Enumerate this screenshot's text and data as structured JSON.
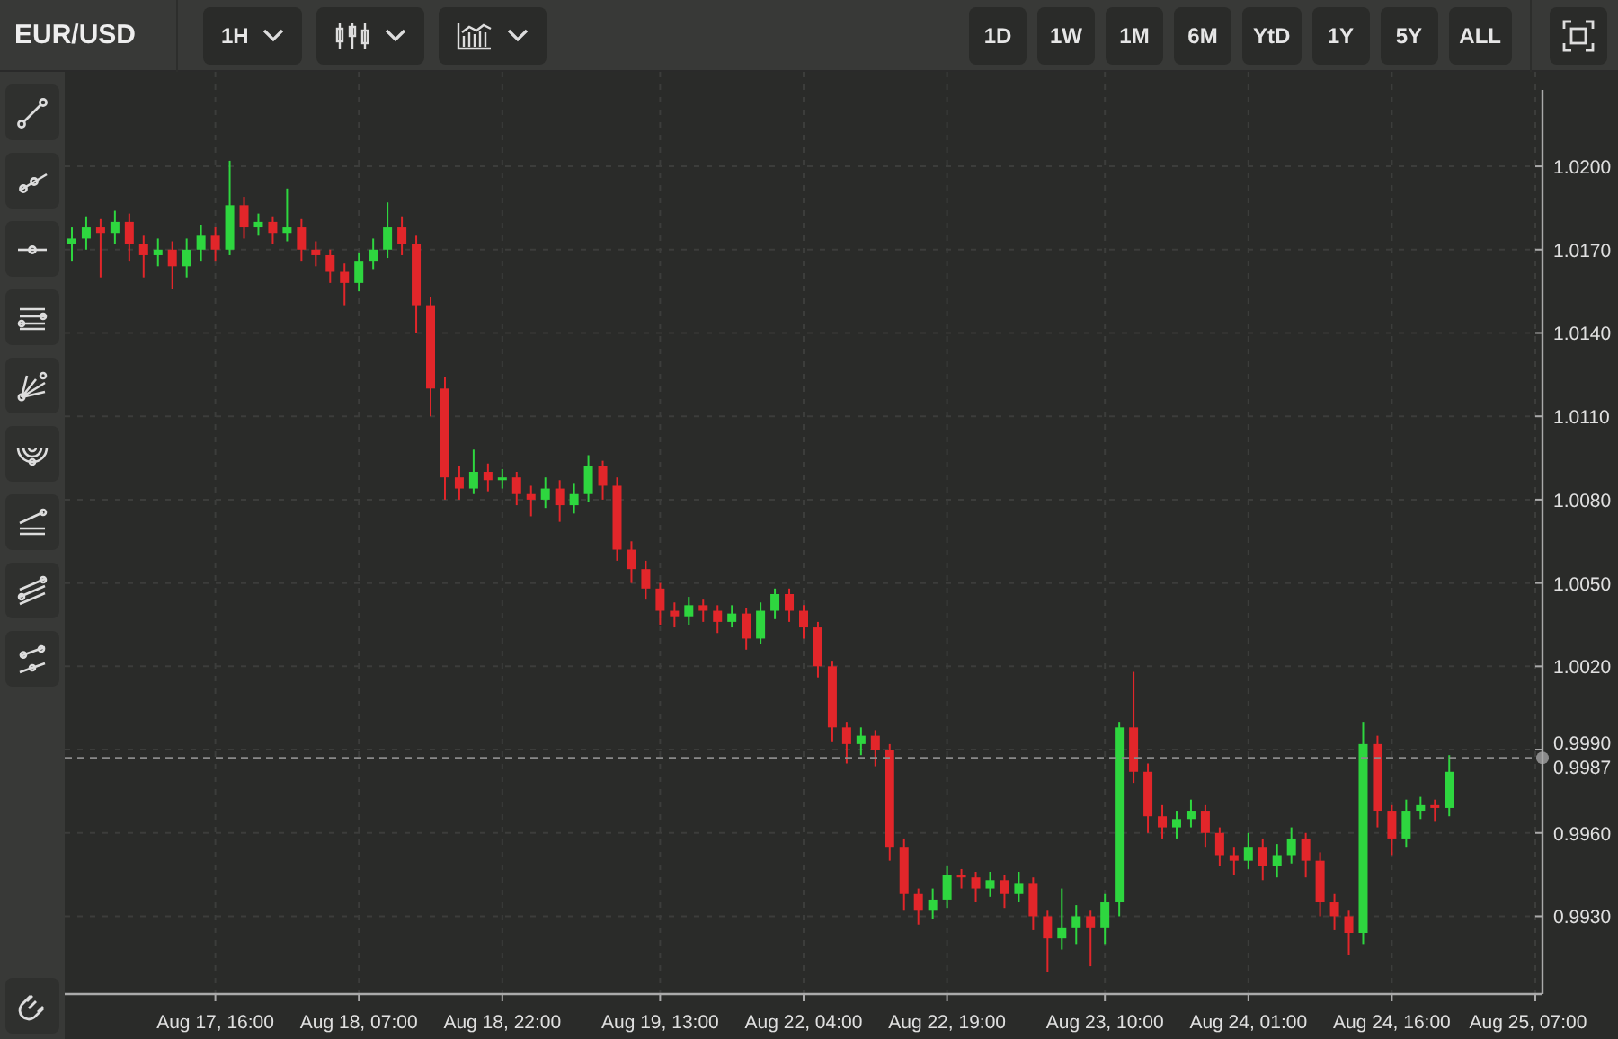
{
  "toolbar": {
    "symbol": "EUR/USD",
    "interval": "1H",
    "ranges": [
      {
        "label": "1D"
      },
      {
        "label": "1W"
      },
      {
        "label": "1M"
      },
      {
        "label": "6M"
      },
      {
        "label": "YtD"
      },
      {
        "label": "1Y"
      },
      {
        "label": "5Y"
      },
      {
        "label": "ALL"
      }
    ]
  },
  "chart": {
    "chart_data": {
      "type": "candlestick",
      "grid": true,
      "ref_lines": [
        {
          "axis": "y",
          "value": 0.9987,
          "label": "0.9987"
        }
      ],
      "categories": [
        null,
        null,
        null,
        null,
        null,
        null,
        null,
        null,
        null,
        null,
        "Aug 17, 16:00",
        null,
        null,
        null,
        null,
        null,
        null,
        null,
        null,
        null,
        "Aug 18, 07:00",
        null,
        null,
        null,
        null,
        null,
        null,
        null,
        null,
        null,
        "Aug 18, 22:00",
        null,
        null,
        null,
        null,
        null,
        null,
        null,
        null,
        null,
        null,
        "Aug 19, 13:00",
        null,
        null,
        null,
        null,
        null,
        null,
        null,
        null,
        null,
        "Aug 22, 04:00",
        null,
        null,
        null,
        null,
        null,
        null,
        null,
        null,
        null,
        "Aug 22, 19:00",
        null,
        null,
        null,
        null,
        null,
        null,
        null,
        null,
        null,
        null,
        "Aug 23, 10:00",
        null,
        null,
        null,
        null,
        null,
        null,
        null,
        null,
        null,
        "Aug 24, 01:00",
        null,
        null,
        null,
        null,
        null,
        null,
        null,
        null,
        null,
        "Aug 24, 16:00",
        null,
        null,
        null,
        null,
        null,
        null,
        null,
        null,
        null,
        "Aug 25, 07:00"
      ],
      "ohlc": [
        [
          1.0172,
          1.0178,
          1.0166,
          1.0174
        ],
        [
          1.0174,
          1.0182,
          1.017,
          1.0178
        ],
        [
          1.0178,
          1.0181,
          1.016,
          1.0176
        ],
        [
          1.0176,
          1.0184,
          1.0172,
          1.018
        ],
        [
          1.018,
          1.0183,
          1.0166,
          1.0172
        ],
        [
          1.0172,
          1.0175,
          1.016,
          1.0168
        ],
        [
          1.0168,
          1.0174,
          1.0164,
          1.017
        ],
        [
          1.017,
          1.0173,
          1.0156,
          1.0164
        ],
        [
          1.0164,
          1.0174,
          1.016,
          1.017
        ],
        [
          1.017,
          1.0179,
          1.0166,
          1.0175
        ],
        [
          1.0175,
          1.0178,
          1.0166,
          1.017
        ],
        [
          1.017,
          1.0202,
          1.0168,
          1.0186
        ],
        [
          1.0186,
          1.0189,
          1.0174,
          1.0178
        ],
        [
          1.0178,
          1.0183,
          1.0175,
          1.018
        ],
        [
          1.018,
          1.0182,
          1.0172,
          1.0176
        ],
        [
          1.0176,
          1.0192,
          1.0173,
          1.0178
        ],
        [
          1.0178,
          1.0181,
          1.0166,
          1.017
        ],
        [
          1.017,
          1.0173,
          1.0164,
          1.0168
        ],
        [
          1.0168,
          1.017,
          1.0158,
          1.0162
        ],
        [
          1.0162,
          1.0165,
          1.015,
          1.0158
        ],
        [
          1.0158,
          1.0169,
          1.0155,
          1.0166
        ],
        [
          1.0166,
          1.0174,
          1.0163,
          1.017
        ],
        [
          1.017,
          1.0187,
          1.0167,
          1.0178
        ],
        [
          1.0178,
          1.0182,
          1.0168,
          1.0172
        ],
        [
          1.0172,
          1.0175,
          1.014,
          1.015
        ],
        [
          1.015,
          1.0153,
          1.011,
          1.012
        ],
        [
          1.012,
          1.0124,
          1.008,
          1.0088
        ],
        [
          1.0088,
          1.0092,
          1.008,
          1.0084
        ],
        [
          1.0084,
          1.0098,
          1.0082,
          1.009
        ],
        [
          1.009,
          1.0093,
          1.0083,
          1.0087
        ],
        [
          1.0087,
          1.0091,
          1.0084,
          1.0088
        ],
        [
          1.0088,
          1.009,
          1.0078,
          1.0082
        ],
        [
          1.0082,
          1.0085,
          1.0074,
          1.008
        ],
        [
          1.008,
          1.0088,
          1.0077,
          1.0084
        ],
        [
          1.0084,
          1.0087,
          1.0072,
          1.0078
        ],
        [
          1.0078,
          1.0086,
          1.0075,
          1.0082
        ],
        [
          1.0082,
          1.0096,
          1.0079,
          1.0092
        ],
        [
          1.0092,
          1.0094,
          1.008,
          1.0085
        ],
        [
          1.0085,
          1.0088,
          1.0058,
          1.0062
        ],
        [
          1.0062,
          1.0065,
          1.005,
          1.0055
        ],
        [
          1.0055,
          1.0058,
          1.0044,
          1.0048
        ],
        [
          1.0048,
          1.005,
          1.0035,
          1.004
        ],
        [
          1.004,
          1.0043,
          1.0034,
          1.0038
        ],
        [
          1.0038,
          1.0045,
          1.0035,
          1.0042
        ],
        [
          1.0042,
          1.0044,
          1.0036,
          1.004
        ],
        [
          1.004,
          1.0042,
          1.0032,
          1.0036
        ],
        [
          1.0036,
          1.0042,
          1.0034,
          1.0039
        ],
        [
          1.0039,
          1.0041,
          1.0026,
          1.003
        ],
        [
          1.003,
          1.0043,
          1.0028,
          1.004
        ],
        [
          1.004,
          1.0048,
          1.0037,
          1.0046
        ],
        [
          1.0046,
          1.0048,
          1.0036,
          1.004
        ],
        [
          1.004,
          1.0042,
          1.003,
          1.0034
        ],
        [
          1.0034,
          1.0036,
          1.0016,
          1.002
        ],
        [
          1.002,
          1.0022,
          0.9993,
          0.9998
        ],
        [
          0.9998,
          1.0,
          0.9985,
          0.9992
        ],
        [
          0.9992,
          0.9998,
          0.9988,
          0.9995
        ],
        [
          0.9995,
          0.9997,
          0.9984,
          0.999
        ],
        [
          0.999,
          0.9992,
          0.995,
          0.9955
        ],
        [
          0.9955,
          0.9958,
          0.9932,
          0.9938
        ],
        [
          0.9938,
          0.994,
          0.9927,
          0.9932
        ],
        [
          0.9932,
          0.994,
          0.9929,
          0.9936
        ],
        [
          0.9936,
          0.9948,
          0.9933,
          0.9945
        ],
        [
          0.9945,
          0.9947,
          0.994,
          0.9944
        ],
        [
          0.9944,
          0.9946,
          0.9935,
          0.994
        ],
        [
          0.994,
          0.9946,
          0.9937,
          0.9943
        ],
        [
          0.9943,
          0.9945,
          0.9933,
          0.9938
        ],
        [
          0.9938,
          0.9946,
          0.9935,
          0.9942
        ],
        [
          0.9942,
          0.9944,
          0.9925,
          0.993
        ],
        [
          0.993,
          0.9932,
          0.991,
          0.9922
        ],
        [
          0.9922,
          0.994,
          0.9918,
          0.9926
        ],
        [
          0.9926,
          0.9934,
          0.992,
          0.993
        ],
        [
          0.993,
          0.9932,
          0.9912,
          0.9926
        ],
        [
          0.9926,
          0.9938,
          0.992,
          0.9935
        ],
        [
          0.9935,
          1.0,
          0.993,
          0.9998
        ],
        [
          0.9998,
          1.0018,
          0.9978,
          0.9982
        ],
        [
          0.9982,
          0.9985,
          0.996,
          0.9966
        ],
        [
          0.9966,
          0.997,
          0.9958,
          0.9962
        ],
        [
          0.9962,
          0.9968,
          0.9958,
          0.9965
        ],
        [
          0.9965,
          0.9972,
          0.9962,
          0.9968
        ],
        [
          0.9968,
          0.997,
          0.9955,
          0.996
        ],
        [
          0.996,
          0.9962,
          0.9948,
          0.9952
        ],
        [
          0.9952,
          0.9955,
          0.9945,
          0.995
        ],
        [
          0.995,
          0.996,
          0.9947,
          0.9955
        ],
        [
          0.9955,
          0.9958,
          0.9943,
          0.9948
        ],
        [
          0.9948,
          0.9956,
          0.9944,
          0.9952
        ],
        [
          0.9952,
          0.9962,
          0.9949,
          0.9958
        ],
        [
          0.9958,
          0.996,
          0.9944,
          0.995
        ],
        [
          0.995,
          0.9953,
          0.993,
          0.9935
        ],
        [
          0.9935,
          0.9938,
          0.9925,
          0.993
        ],
        [
          0.993,
          0.9932,
          0.9916,
          0.9924
        ],
        [
          0.9924,
          1.0,
          0.992,
          0.9992
        ],
        [
          0.9992,
          0.9995,
          0.9962,
          0.9968
        ],
        [
          0.9968,
          0.997,
          0.9952,
          0.9958
        ],
        [
          0.9958,
          0.9972,
          0.9955,
          0.9968
        ],
        [
          0.9968,
          0.9973,
          0.9965,
          0.997
        ],
        [
          0.997,
          0.9972,
          0.9964,
          0.9969
        ],
        [
          0.9969,
          0.9988,
          0.9966,
          0.9982
        ],
        null,
        null,
        null,
        null,
        null,
        null
      ],
      "ylim": [
        0.9902,
        1.0234
      ],
      "yticks": [
        {
          "value": 1.02,
          "label": "1.0200"
        },
        {
          "value": 1.017,
          "label": "1.0170"
        },
        {
          "value": 1.014,
          "label": "1.0140"
        },
        {
          "value": 1.011,
          "label": "1.0110"
        },
        {
          "value": 1.008,
          "label": "1.0080"
        },
        {
          "value": 1.005,
          "label": "1.0050"
        },
        {
          "value": 1.002,
          "label": "1.0020"
        },
        {
          "value": 0.999,
          "label": "0.9990"
        },
        {
          "value": 0.996,
          "label": "0.9960"
        },
        {
          "value": 0.993,
          "label": "0.9930"
        }
      ]
    }
  }
}
